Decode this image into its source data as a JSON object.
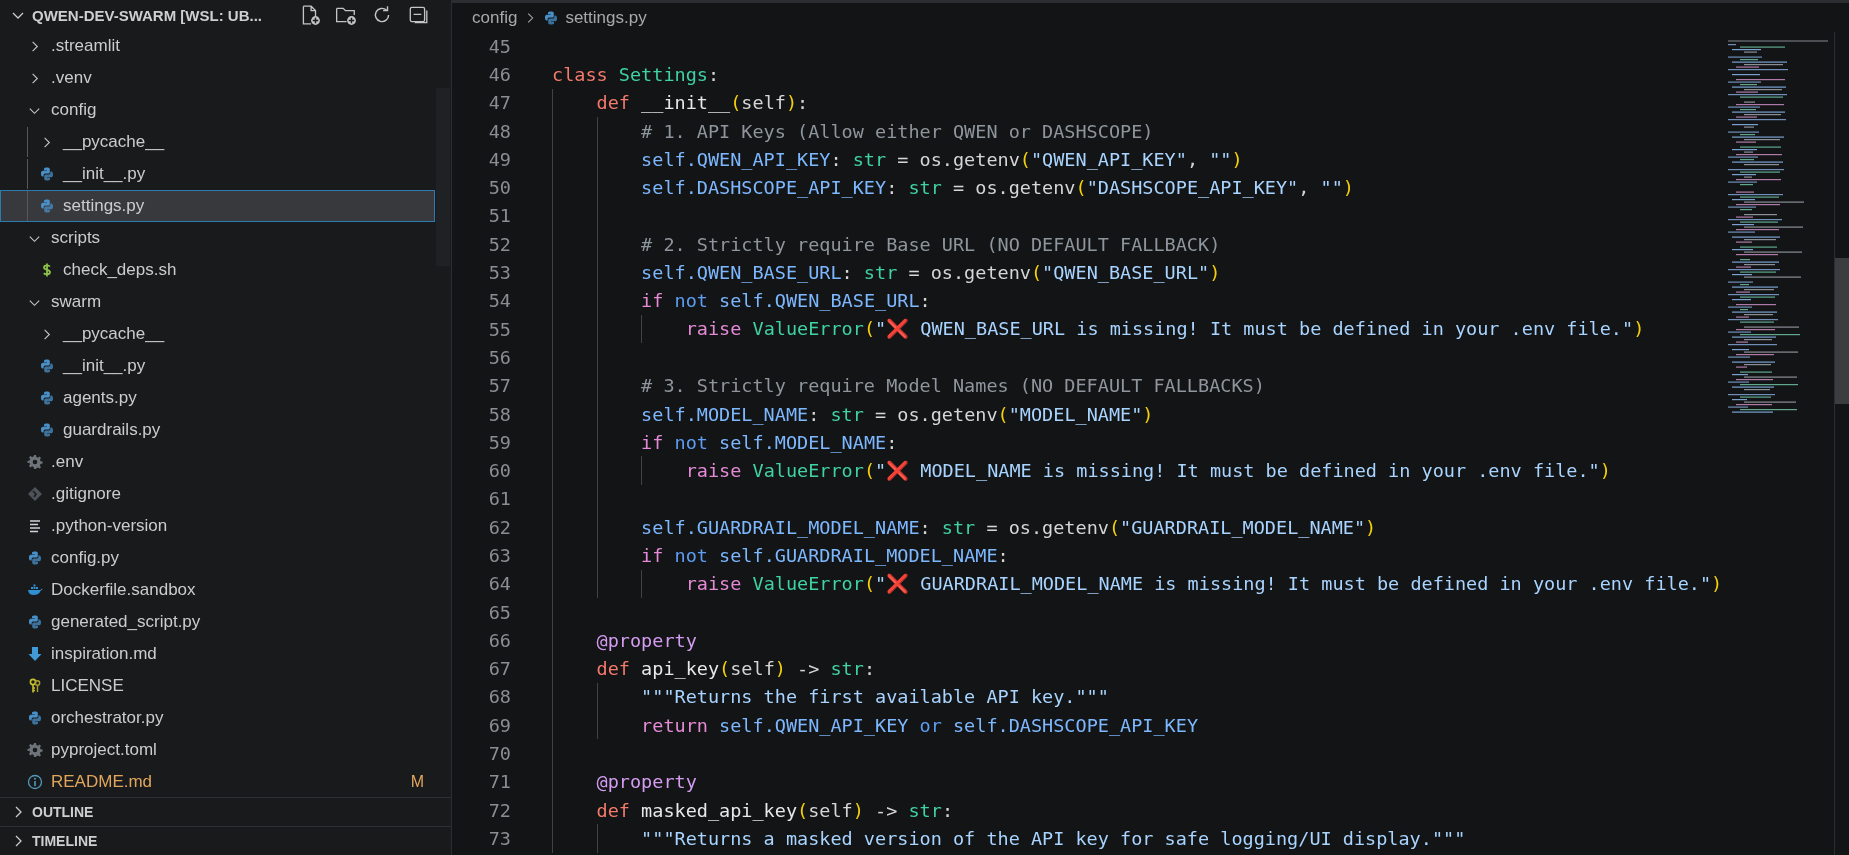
{
  "explorer": {
    "title": "QWEN-DEV-SWARM [WSL: UB...",
    "expanded": true,
    "items": [
      {
        "kind": "folder",
        "label": ".streamlit",
        "expanded": false,
        "selected": false
      },
      {
        "kind": "folder",
        "label": ".venv",
        "expanded": false,
        "selected": false
      },
      {
        "kind": "folder",
        "label": "config",
        "expanded": true,
        "selected": false,
        "children": [
          {
            "kind": "folder",
            "label": "__pycache__",
            "expanded": false,
            "selected": false
          },
          {
            "kind": "python",
            "label": "__init__.py",
            "selected": false
          },
          {
            "kind": "python",
            "label": "settings.py",
            "selected": true
          }
        ]
      },
      {
        "kind": "folder",
        "label": "scripts",
        "expanded": true,
        "selected": false,
        "children": [
          {
            "kind": "shell",
            "label": "check_deps.sh",
            "selected": false
          }
        ]
      },
      {
        "kind": "folder",
        "label": "swarm",
        "expanded": true,
        "selected": false,
        "children": [
          {
            "kind": "folder",
            "label": "__pycache__",
            "expanded": false,
            "selected": false
          },
          {
            "kind": "python",
            "label": "__init__.py",
            "selected": false
          },
          {
            "kind": "python",
            "label": "agents.py",
            "selected": false
          },
          {
            "kind": "python",
            "label": "guardrails.py",
            "selected": false
          }
        ]
      },
      {
        "kind": "gear",
        "label": ".env",
        "selected": false
      },
      {
        "kind": "git",
        "label": ".gitignore",
        "selected": false
      },
      {
        "kind": "lines",
        "label": ".python-version",
        "selected": false
      },
      {
        "kind": "python",
        "label": "config.py",
        "selected": false
      },
      {
        "kind": "docker",
        "label": "Dockerfile.sandbox",
        "selected": false
      },
      {
        "kind": "python",
        "label": "generated_script.py",
        "selected": false
      },
      {
        "kind": "markdown",
        "label": "inspiration.md",
        "selected": false
      },
      {
        "kind": "license",
        "label": "LICENSE",
        "selected": false
      },
      {
        "kind": "python",
        "label": "orchestrator.py",
        "selected": false
      },
      {
        "kind": "gear",
        "label": "pyproject.toml",
        "selected": false
      },
      {
        "kind": "info",
        "label": "README.md",
        "selected": false,
        "modified": true,
        "badge": "M"
      }
    ]
  },
  "panels": [
    {
      "label": "OUTLINE",
      "expanded": false
    },
    {
      "label": "TIMELINE",
      "expanded": false
    }
  ],
  "breadcrumb": [
    {
      "kind": "folder",
      "label": "config"
    },
    {
      "kind": "python",
      "label": "settings.py"
    }
  ],
  "code": [
    {
      "number": "45"
    },
    {
      "number": "46",
      "tokens": [
        {
          "kind": "keyword",
          "text": "class"
        },
        {
          "kind": "type",
          "text": " Settings"
        },
        {
          "kind": "plain",
          "text": ":"
        }
      ]
    },
    {
      "number": "47",
      "tokens": [
        {
          "kind": "keyword",
          "text": "    def"
        },
        {
          "kind": "function",
          "text": " __init__"
        },
        {
          "kind": "paren",
          "text": "("
        },
        {
          "kind": "plain",
          "text": "self"
        },
        {
          "kind": "paren",
          "text": ")"
        },
        {
          "kind": "plain",
          "text": ":"
        }
      ]
    },
    {
      "number": "48",
      "tokens": [
        {
          "kind": "comment",
          "text": "        # 1. API Keys (Allow either QWEN or DASHSCOPE)"
        }
      ]
    },
    {
      "number": "49",
      "tokens": [
        {
          "kind": "variable",
          "text": "        self.QWEN_API_KEY"
        },
        {
          "kind": "plain",
          "text": ":"
        },
        {
          "kind": "type",
          "text": " str"
        },
        {
          "kind": "plain",
          "text": " = os.getenv"
        },
        {
          "kind": "paren",
          "text": "("
        },
        {
          "kind": "string",
          "text": "\"QWEN_API_KEY\""
        },
        {
          "kind": "plain",
          "text": ","
        },
        {
          "kind": "string",
          "text": " \"\""
        },
        {
          "kind": "paren",
          "text": ")"
        }
      ]
    },
    {
      "number": "50",
      "tokens": [
        {
          "kind": "variable",
          "text": "        self.DASHSCOPE_API_KEY"
        },
        {
          "kind": "plain",
          "text": ":"
        },
        {
          "kind": "type",
          "text": " str"
        },
        {
          "kind": "plain",
          "text": " = os.getenv"
        },
        {
          "kind": "paren",
          "text": "("
        },
        {
          "kind": "string",
          "text": "\"DASHSCOPE_API_KEY\""
        },
        {
          "kind": "plain",
          "text": ","
        },
        {
          "kind": "string",
          "text": " \"\""
        },
        {
          "kind": "paren",
          "text": ")"
        }
      ]
    },
    {
      "number": "51"
    },
    {
      "number": "52",
      "tokens": [
        {
          "kind": "comment",
          "text": "        # 2. Strictly require Base URL (NO DEFAULT FALLBACK)"
        }
      ]
    },
    {
      "number": "53",
      "tokens": [
        {
          "kind": "variable",
          "text": "        self.QWEN_BASE_URL"
        },
        {
          "kind": "plain",
          "text": ":"
        },
        {
          "kind": "type",
          "text": " str"
        },
        {
          "kind": "plain",
          "text": " = os.getenv"
        },
        {
          "kind": "paren",
          "text": "("
        },
        {
          "kind": "string",
          "text": "\"QWEN_BASE_URL\""
        },
        {
          "kind": "paren",
          "text": ")"
        }
      ]
    },
    {
      "number": "54",
      "tokens": [
        {
          "kind": "control",
          "text": "        if"
        },
        {
          "kind": "operator",
          "text": " not"
        },
        {
          "kind": "variable",
          "text": " self.QWEN_BASE_URL"
        },
        {
          "kind": "plain",
          "text": ":"
        }
      ]
    },
    {
      "number": "55",
      "tokens": [
        {
          "kind": "control",
          "text": "            raise"
        },
        {
          "kind": "type",
          "text": " ValueError"
        },
        {
          "kind": "paren",
          "text": "("
        },
        {
          "kind": "string",
          "text": "\""
        },
        {
          "kind": "emoji",
          "text": "❌"
        },
        {
          "kind": "string",
          "text": " QWEN_BASE_URL is missing! It must be defined in your .env file.\""
        },
        {
          "kind": "paren",
          "text": ")"
        }
      ]
    },
    {
      "number": "56"
    },
    {
      "number": "57",
      "tokens": [
        {
          "kind": "comment",
          "text": "        # 3. Strictly require Model Names (NO DEFAULT FALLBACKS)"
        }
      ]
    },
    {
      "number": "58",
      "tokens": [
        {
          "kind": "variable",
          "text": "        self.MODEL_NAME"
        },
        {
          "kind": "plain",
          "text": ":"
        },
        {
          "kind": "type",
          "text": " str"
        },
        {
          "kind": "plain",
          "text": " = os.getenv"
        },
        {
          "kind": "paren",
          "text": "("
        },
        {
          "kind": "string",
          "text": "\"MODEL_NAME\""
        },
        {
          "kind": "paren",
          "text": ")"
        }
      ]
    },
    {
      "number": "59",
      "tokens": [
        {
          "kind": "control",
          "text": "        if"
        },
        {
          "kind": "operator",
          "text": " not"
        },
        {
          "kind": "variable",
          "text": " self.MODEL_NAME"
        },
        {
          "kind": "plain",
          "text": ":"
        }
      ]
    },
    {
      "number": "60",
      "tokens": [
        {
          "kind": "control",
          "text": "            raise"
        },
        {
          "kind": "type",
          "text": " ValueError"
        },
        {
          "kind": "paren",
          "text": "("
        },
        {
          "kind": "string",
          "text": "\""
        },
        {
          "kind": "emoji",
          "text": "❌"
        },
        {
          "kind": "string",
          "text": " MODEL_NAME is missing! It must be defined in your .env file.\""
        },
        {
          "kind": "paren",
          "text": ")"
        }
      ]
    },
    {
      "number": "61"
    },
    {
      "number": "62",
      "tokens": [
        {
          "kind": "variable",
          "text": "        self.GUARDRAIL_MODEL_NAME"
        },
        {
          "kind": "plain",
          "text": ":"
        },
        {
          "kind": "type",
          "text": " str"
        },
        {
          "kind": "plain",
          "text": " = os.getenv"
        },
        {
          "kind": "paren",
          "text": "("
        },
        {
          "kind": "string",
          "text": "\"GUARDRAIL_MODEL_NAME\""
        },
        {
          "kind": "paren",
          "text": ")"
        }
      ]
    },
    {
      "number": "63",
      "tokens": [
        {
          "kind": "control",
          "text": "        if"
        },
        {
          "kind": "operator",
          "text": " not"
        },
        {
          "kind": "variable",
          "text": " self.GUARDRAIL_MODEL_NAME"
        },
        {
          "kind": "plain",
          "text": ":"
        }
      ]
    },
    {
      "number": "64",
      "tokens": [
        {
          "kind": "control",
          "text": "            raise"
        },
        {
          "kind": "type",
          "text": " ValueError"
        },
        {
          "kind": "paren",
          "text": "("
        },
        {
          "kind": "string",
          "text": "\""
        },
        {
          "kind": "emoji",
          "text": "❌"
        },
        {
          "kind": "string",
          "text": " GUARDRAIL_MODEL_NAME is missing! It must be defined in your .env file.\""
        },
        {
          "kind": "paren",
          "text": ")"
        }
      ]
    },
    {
      "number": "65"
    },
    {
      "number": "66",
      "tokens": [
        {
          "kind": "decorator",
          "text": "    @property"
        }
      ]
    },
    {
      "number": "67",
      "tokens": [
        {
          "kind": "keyword",
          "text": "    def"
        },
        {
          "kind": "function",
          "text": " api_key"
        },
        {
          "kind": "paren",
          "text": "("
        },
        {
          "kind": "plain",
          "text": "self"
        },
        {
          "kind": "paren",
          "text": ")"
        },
        {
          "kind": "plain",
          "text": " ->"
        },
        {
          "kind": "type",
          "text": " str"
        },
        {
          "kind": "plain",
          "text": ":"
        }
      ]
    },
    {
      "number": "68",
      "tokens": [
        {
          "kind": "string",
          "text": "        \"\"\"Returns the first available API key.\"\"\""
        }
      ]
    },
    {
      "number": "69",
      "tokens": [
        {
          "kind": "control",
          "text": "        return"
        },
        {
          "kind": "variable",
          "text": " self.QWEN_API_KEY"
        },
        {
          "kind": "operator",
          "text": " or"
        },
        {
          "kind": "variable",
          "text": " self.DASHSCOPE_API_KEY"
        }
      ]
    },
    {
      "number": "70"
    },
    {
      "number": "71",
      "tokens": [
        {
          "kind": "decorator",
          "text": "    @property"
        }
      ]
    },
    {
      "number": "72",
      "tokens": [
        {
          "kind": "keyword",
          "text": "    def"
        },
        {
          "kind": "function",
          "text": " masked_api_key"
        },
        {
          "kind": "paren",
          "text": "("
        },
        {
          "kind": "plain",
          "text": "self"
        },
        {
          "kind": "paren",
          "text": ")"
        },
        {
          "kind": "plain",
          "text": " ->"
        },
        {
          "kind": "type",
          "text": " str"
        },
        {
          "kind": "plain",
          "text": ":"
        }
      ]
    },
    {
      "number": "73",
      "tokens": [
        {
          "kind": "string",
          "text": "        \"\"\"Returns a masked version of the API key for safe logging/UI display.\"\"\""
        }
      ]
    }
  ]
}
